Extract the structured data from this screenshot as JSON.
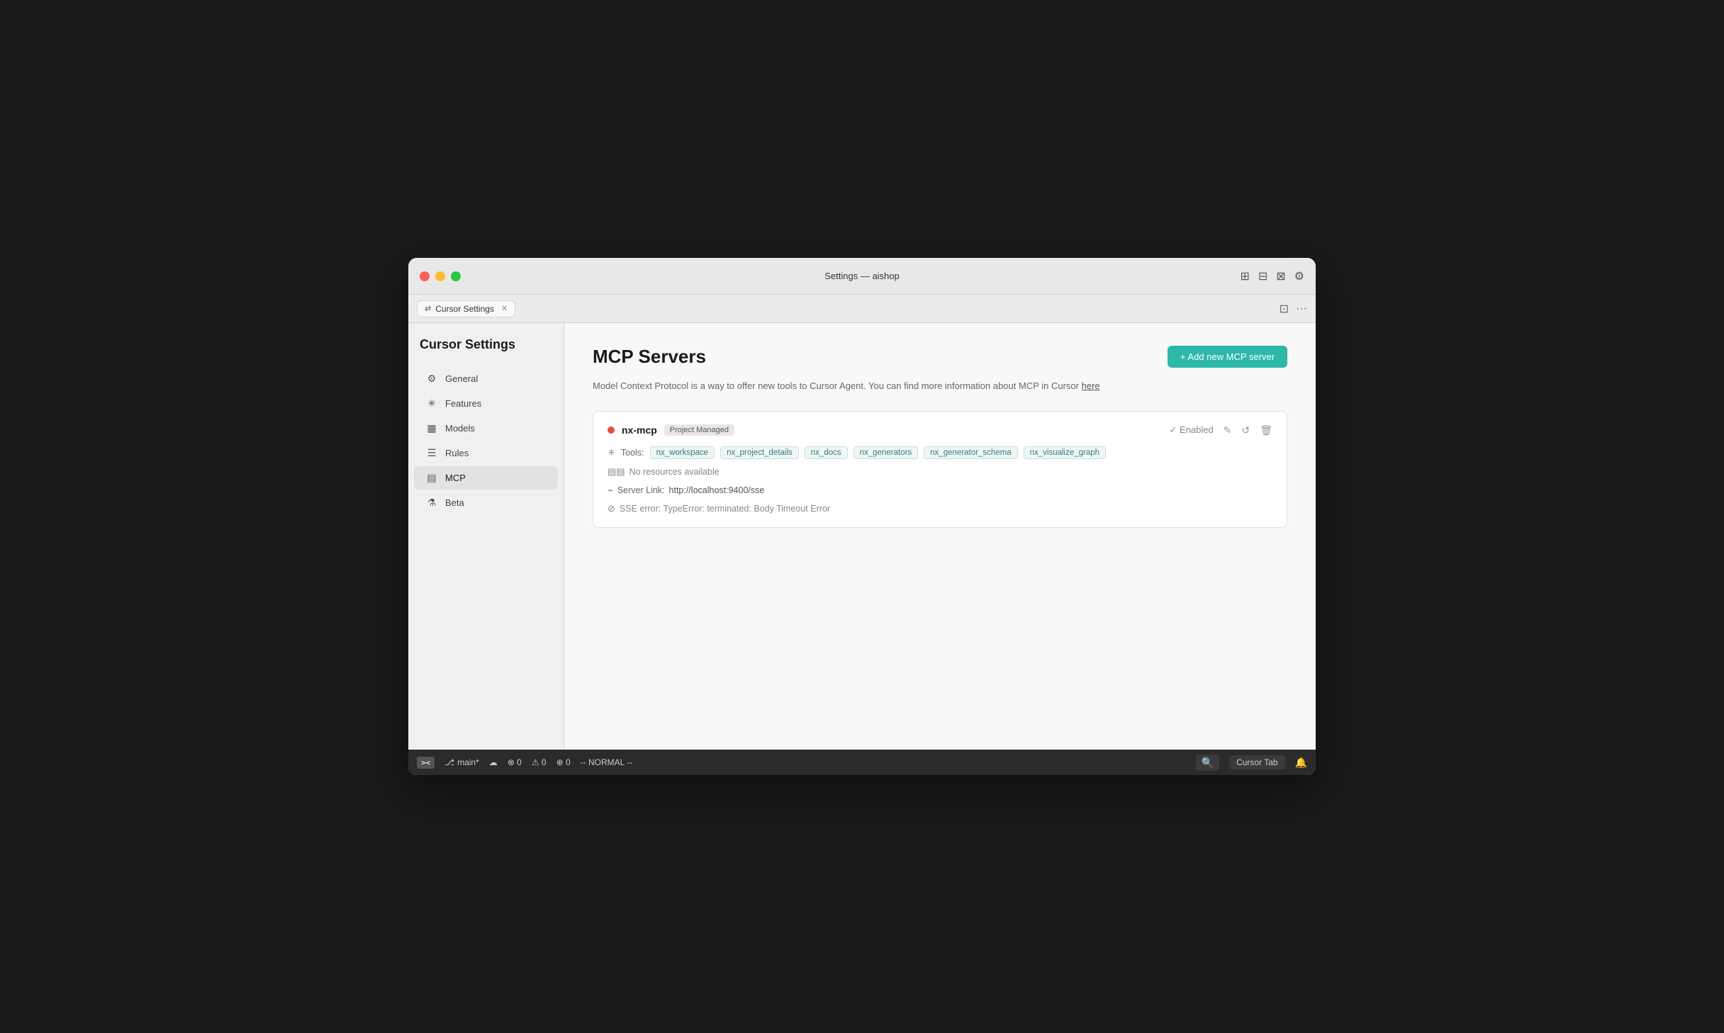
{
  "window": {
    "title": "Settings — aishop"
  },
  "titlebar": {
    "title": "Settings — aishop",
    "icons": {
      "layout1": "⊞",
      "layout2": "⊟",
      "layout3": "⊠",
      "settings": "⚙"
    }
  },
  "tabbar": {
    "tab": {
      "icon": "⇄",
      "label": "Cursor Settings",
      "close": "✕"
    },
    "right_icons": [
      "⊡",
      "···"
    ]
  },
  "sidebar": {
    "title": "Cursor Settings",
    "items": [
      {
        "id": "general",
        "icon": "⚙",
        "label": "General",
        "active": false
      },
      {
        "id": "features",
        "icon": "✳",
        "label": "Features",
        "active": false
      },
      {
        "id": "models",
        "icon": "▦",
        "label": "Models",
        "active": false
      },
      {
        "id": "rules",
        "icon": "☰",
        "label": "Rules",
        "active": false
      },
      {
        "id": "mcp",
        "icon": "▤",
        "label": "MCP",
        "active": true
      },
      {
        "id": "beta",
        "icon": "⚗",
        "label": "Beta",
        "active": false
      }
    ]
  },
  "content": {
    "title": "MCP Servers",
    "description": "Model Context Protocol is a way to offer new tools to Cursor Agent. You can find more information about MCP in Cursor",
    "description_link": "here",
    "add_button": "+ Add new MCP server",
    "server": {
      "name": "nx-mcp",
      "badge": "Project Managed",
      "status_dot_color": "#e74c3c",
      "enabled_label": "✓ Enabled",
      "tools_label": "Tools:",
      "tools": [
        "nx_workspace",
        "nx_project_details",
        "nx_docs",
        "nx_generators",
        "nx_generator_schema",
        "nx_visualize_graph"
      ],
      "no_resources": "No resources available",
      "server_link_label": "Server Link:",
      "server_link_url": "http://localhost:9400/sse",
      "sse_error": "SSE error: TypeError: terminated: Body Timeout Error"
    }
  },
  "statusbar": {
    "terminal_icon": "><",
    "branch": "main*",
    "cloud_icon": "☁",
    "errors": "⊗ 0",
    "warnings": "⚠ 0",
    "broadcast": "⊕ 0",
    "mode": "-- NORMAL --",
    "search_icon": "🔍",
    "cursor_tab": "Cursor Tab",
    "bell_icon": "🔔"
  }
}
